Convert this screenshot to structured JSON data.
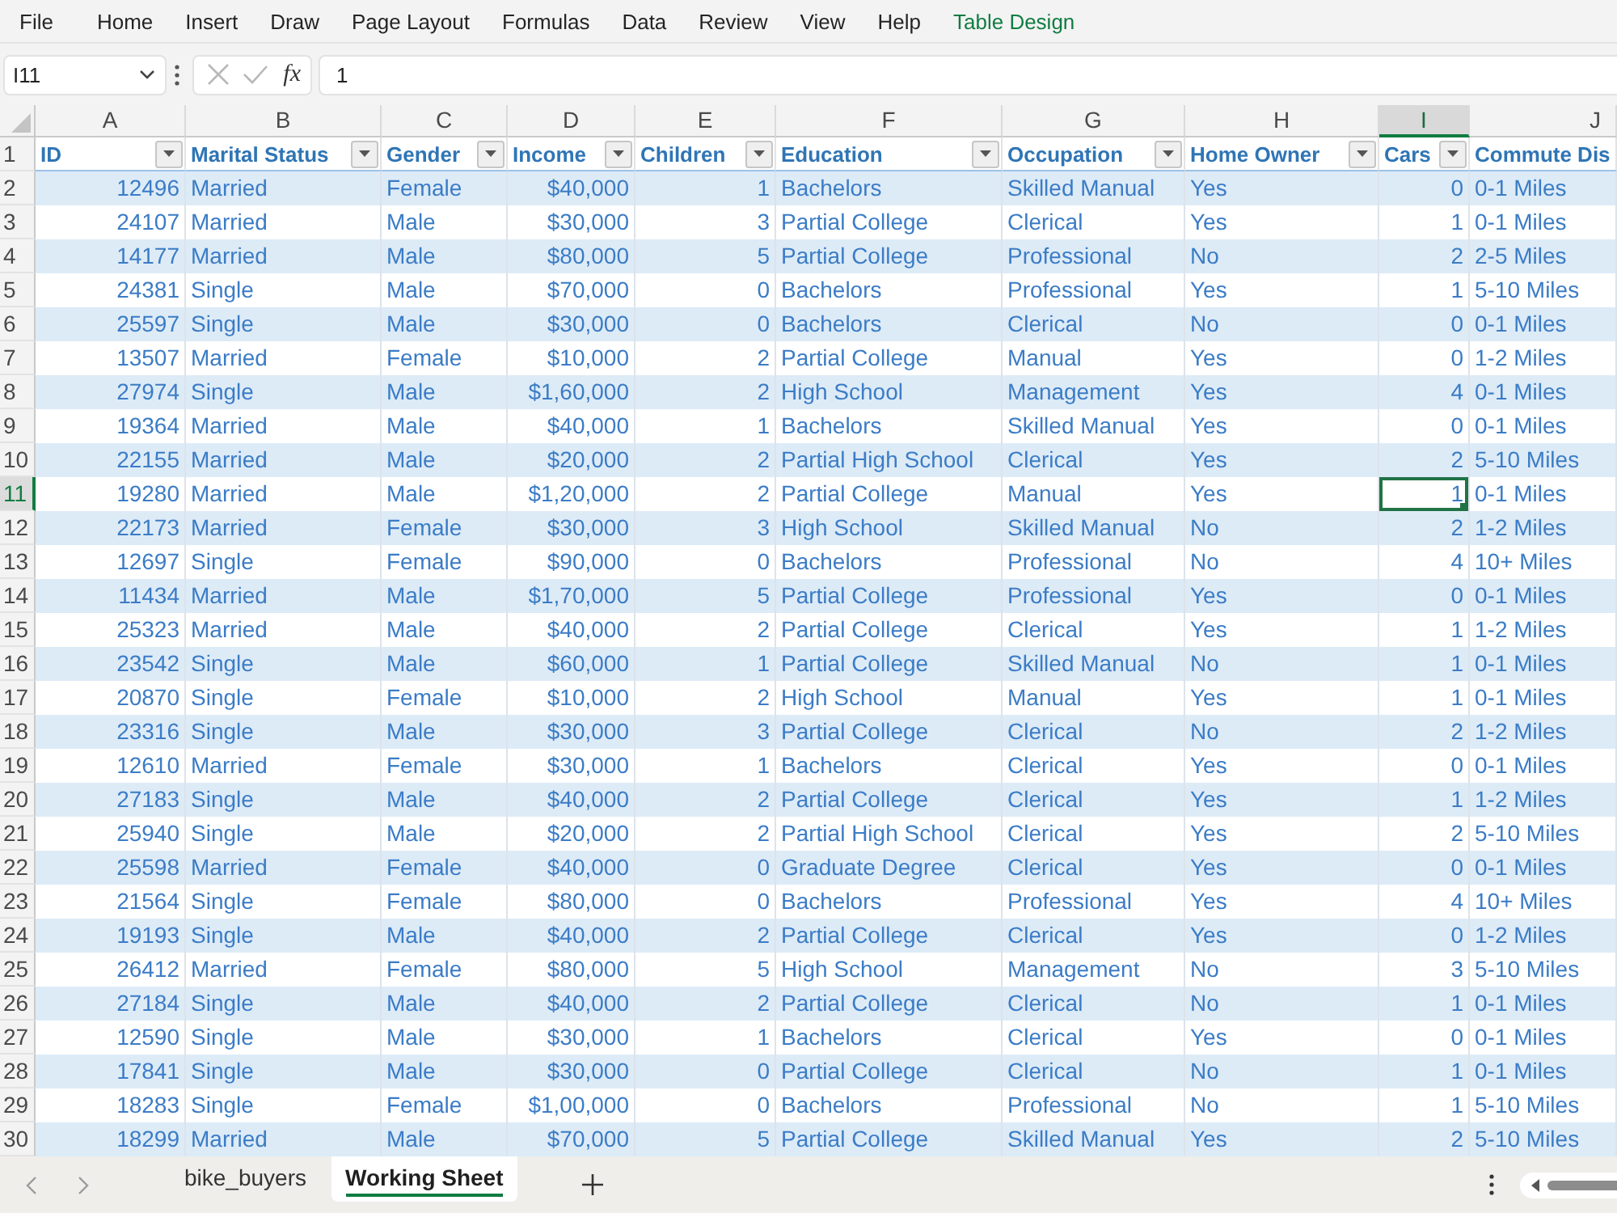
{
  "menu_bar": [
    {
      "label": "File",
      "kind": "standard"
    },
    {
      "label": "Home",
      "kind": "standard"
    },
    {
      "label": "Insert",
      "kind": "standard"
    },
    {
      "label": "Draw",
      "kind": "standard"
    },
    {
      "label": "Page Layout",
      "kind": "standard"
    },
    {
      "label": "Formulas",
      "kind": "standard"
    },
    {
      "label": "Data",
      "kind": "standard"
    },
    {
      "label": "Review",
      "kind": "standard"
    },
    {
      "label": "View",
      "kind": "standard"
    },
    {
      "label": "Help",
      "kind": "standard"
    },
    {
      "label": "Table Design",
      "kind": "contextual"
    }
  ],
  "formula_bar": {
    "name_box": "I11",
    "insert_function": "fx",
    "formula": "1"
  },
  "sheet": {
    "header_row_number": "1",
    "columns": [
      {
        "letter": "A",
        "title": "ID",
        "kind": "number",
        "filter": true,
        "selected": false
      },
      {
        "letter": "B",
        "title": "Marital Status",
        "kind": "text",
        "filter": true,
        "selected": false
      },
      {
        "letter": "C",
        "title": "Gender",
        "kind": "text",
        "filter": true,
        "selected": false
      },
      {
        "letter": "D",
        "title": "Income",
        "kind": "number",
        "filter": true,
        "selected": false
      },
      {
        "letter": "E",
        "title": "Children",
        "kind": "number",
        "filter": true,
        "selected": false
      },
      {
        "letter": "F",
        "title": "Education",
        "kind": "text",
        "filter": true,
        "selected": false
      },
      {
        "letter": "G",
        "title": "Occupation",
        "kind": "text",
        "filter": true,
        "selected": false
      },
      {
        "letter": "H",
        "title": "Home Owner",
        "kind": "text",
        "filter": true,
        "selected": false
      },
      {
        "letter": "I",
        "title": "Cars",
        "kind": "number",
        "filter": true,
        "selected": true
      },
      {
        "letter": "J",
        "title": "Commute Dis",
        "kind": "text",
        "filter": false,
        "selected": false
      }
    ],
    "rows": [
      {
        "number": "2",
        "selected": false,
        "cells": [
          "12496",
          "Married",
          "Female",
          "$40,000",
          "1",
          "Bachelors",
          "Skilled Manual",
          "Yes",
          "0",
          "0-1 Miles"
        ]
      },
      {
        "number": "3",
        "selected": false,
        "cells": [
          "24107",
          "Married",
          "Male",
          "$30,000",
          "3",
          "Partial College",
          "Clerical",
          "Yes",
          "1",
          "0-1 Miles"
        ]
      },
      {
        "number": "4",
        "selected": false,
        "cells": [
          "14177",
          "Married",
          "Male",
          "$80,000",
          "5",
          "Partial College",
          "Professional",
          "No",
          "2",
          "2-5 Miles"
        ]
      },
      {
        "number": "5",
        "selected": false,
        "cells": [
          "24381",
          "Single",
          "Male",
          "$70,000",
          "0",
          "Bachelors",
          "Professional",
          "Yes",
          "1",
          "5-10 Miles"
        ]
      },
      {
        "number": "6",
        "selected": false,
        "cells": [
          "25597",
          "Single",
          "Male",
          "$30,000",
          "0",
          "Bachelors",
          "Clerical",
          "No",
          "0",
          "0-1 Miles"
        ]
      },
      {
        "number": "7",
        "selected": false,
        "cells": [
          "13507",
          "Married",
          "Female",
          "$10,000",
          "2",
          "Partial College",
          "Manual",
          "Yes",
          "0",
          "1-2 Miles"
        ]
      },
      {
        "number": "8",
        "selected": false,
        "cells": [
          "27974",
          "Single",
          "Male",
          "$1,60,000",
          "2",
          "High School",
          "Management",
          "Yes",
          "4",
          "0-1 Miles"
        ]
      },
      {
        "number": "9",
        "selected": false,
        "cells": [
          "19364",
          "Married",
          "Male",
          "$40,000",
          "1",
          "Bachelors",
          "Skilled Manual",
          "Yes",
          "0",
          "0-1 Miles"
        ]
      },
      {
        "number": "10",
        "selected": false,
        "cells": [
          "22155",
          "Married",
          "Male",
          "$20,000",
          "2",
          "Partial High School",
          "Clerical",
          "Yes",
          "2",
          "5-10 Miles"
        ]
      },
      {
        "number": "11",
        "selected": true,
        "cells": [
          "19280",
          "Married",
          "Male",
          "$1,20,000",
          "2",
          "Partial College",
          "Manual",
          "Yes",
          "1",
          "0-1 Miles"
        ]
      },
      {
        "number": "12",
        "selected": false,
        "cells": [
          "22173",
          "Married",
          "Female",
          "$30,000",
          "3",
          "High School",
          "Skilled Manual",
          "No",
          "2",
          "1-2 Miles"
        ]
      },
      {
        "number": "13",
        "selected": false,
        "cells": [
          "12697",
          "Single",
          "Female",
          "$90,000",
          "0",
          "Bachelors",
          "Professional",
          "No",
          "4",
          "10+ Miles"
        ]
      },
      {
        "number": "14",
        "selected": false,
        "cells": [
          "11434",
          "Married",
          "Male",
          "$1,70,000",
          "5",
          "Partial College",
          "Professional",
          "Yes",
          "0",
          "0-1 Miles"
        ]
      },
      {
        "number": "15",
        "selected": false,
        "cells": [
          "25323",
          "Married",
          "Male",
          "$40,000",
          "2",
          "Partial College",
          "Clerical",
          "Yes",
          "1",
          "1-2 Miles"
        ]
      },
      {
        "number": "16",
        "selected": false,
        "cells": [
          "23542",
          "Single",
          "Male",
          "$60,000",
          "1",
          "Partial College",
          "Skilled Manual",
          "No",
          "1",
          "0-1 Miles"
        ]
      },
      {
        "number": "17",
        "selected": false,
        "cells": [
          "20870",
          "Single",
          "Female",
          "$10,000",
          "2",
          "High School",
          "Manual",
          "Yes",
          "1",
          "0-1 Miles"
        ]
      },
      {
        "number": "18",
        "selected": false,
        "cells": [
          "23316",
          "Single",
          "Male",
          "$30,000",
          "3",
          "Partial College",
          "Clerical",
          "No",
          "2",
          "1-2 Miles"
        ]
      },
      {
        "number": "19",
        "selected": false,
        "cells": [
          "12610",
          "Married",
          "Female",
          "$30,000",
          "1",
          "Bachelors",
          "Clerical",
          "Yes",
          "0",
          "0-1 Miles"
        ]
      },
      {
        "number": "20",
        "selected": false,
        "cells": [
          "27183",
          "Single",
          "Male",
          "$40,000",
          "2",
          "Partial College",
          "Clerical",
          "Yes",
          "1",
          "1-2 Miles"
        ]
      },
      {
        "number": "21",
        "selected": false,
        "cells": [
          "25940",
          "Single",
          "Male",
          "$20,000",
          "2",
          "Partial High School",
          "Clerical",
          "Yes",
          "2",
          "5-10 Miles"
        ]
      },
      {
        "number": "22",
        "selected": false,
        "cells": [
          "25598",
          "Married",
          "Female",
          "$40,000",
          "0",
          "Graduate Degree",
          "Clerical",
          "Yes",
          "0",
          "0-1 Miles"
        ]
      },
      {
        "number": "23",
        "selected": false,
        "cells": [
          "21564",
          "Single",
          "Female",
          "$80,000",
          "0",
          "Bachelors",
          "Professional",
          "Yes",
          "4",
          "10+ Miles"
        ]
      },
      {
        "number": "24",
        "selected": false,
        "cells": [
          "19193",
          "Single",
          "Male",
          "$40,000",
          "2",
          "Partial College",
          "Clerical",
          "Yes",
          "0",
          "1-2 Miles"
        ]
      },
      {
        "number": "25",
        "selected": false,
        "cells": [
          "26412",
          "Married",
          "Female",
          "$80,000",
          "5",
          "High School",
          "Management",
          "No",
          "3",
          "5-10 Miles"
        ]
      },
      {
        "number": "26",
        "selected": false,
        "cells": [
          "27184",
          "Single",
          "Male",
          "$40,000",
          "2",
          "Partial College",
          "Clerical",
          "No",
          "1",
          "0-1 Miles"
        ]
      },
      {
        "number": "27",
        "selected": false,
        "cells": [
          "12590",
          "Single",
          "Male",
          "$30,000",
          "1",
          "Bachelors",
          "Clerical",
          "Yes",
          "0",
          "0-1 Miles"
        ]
      },
      {
        "number": "28",
        "selected": false,
        "cells": [
          "17841",
          "Single",
          "Male",
          "$30,000",
          "0",
          "Partial College",
          "Clerical",
          "No",
          "1",
          "0-1 Miles"
        ]
      },
      {
        "number": "29",
        "selected": false,
        "cells": [
          "18283",
          "Single",
          "Female",
          "$1,00,000",
          "0",
          "Bachelors",
          "Professional",
          "No",
          "1",
          "5-10 Miles"
        ]
      },
      {
        "number": "30",
        "selected": false,
        "cells": [
          "18299",
          "Married",
          "Male",
          "$70,000",
          "5",
          "Partial College",
          "Skilled Manual",
          "Yes",
          "2",
          "5-10 Miles"
        ]
      }
    ]
  },
  "sheet_tabs": [
    {
      "label": "bike_buyers",
      "selected": false
    },
    {
      "label": "Working Sheet",
      "selected": true
    }
  ]
}
